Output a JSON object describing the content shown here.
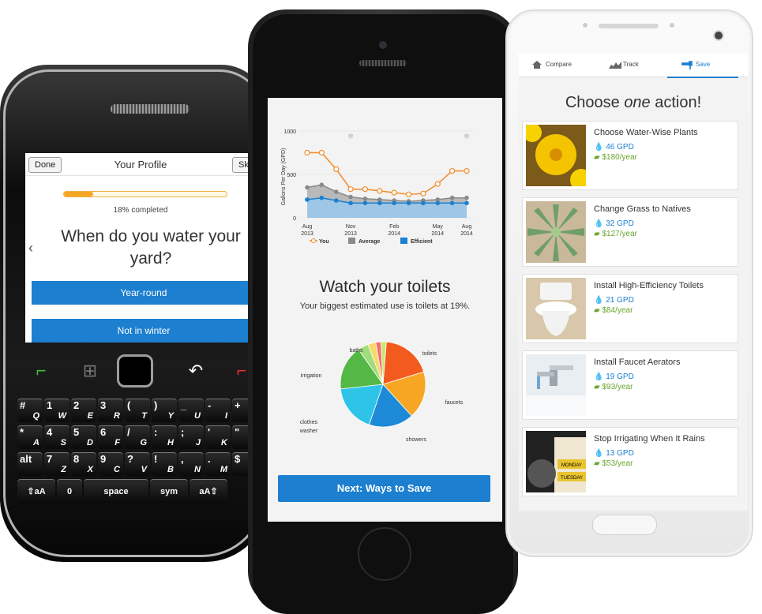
{
  "blackberry": {
    "done_label": "Done",
    "title": "Your Profile",
    "skip_label": "Sk",
    "progress_fraction": 0.18,
    "progress_text": "18% completed",
    "back_glyph": "‹",
    "question": "When do you water your yard?",
    "options": [
      "Year-round",
      "Not in winter"
    ],
    "keys": {
      "row1": [
        [
          "#",
          "Q",
          ""
        ],
        [
          "1",
          "W",
          ""
        ],
        [
          "2",
          "E",
          ""
        ],
        [
          "3",
          "R",
          ""
        ],
        [
          "(",
          "T",
          ""
        ],
        [
          ")",
          "Y",
          ""
        ],
        [
          "_",
          "U",
          ""
        ],
        [
          "-",
          "I",
          ""
        ],
        [
          "+",
          "O",
          ""
        ]
      ],
      "row2": [
        [
          "*",
          "A",
          ""
        ],
        [
          "4",
          "S",
          ""
        ],
        [
          "5",
          "D",
          ""
        ],
        [
          "6",
          "F",
          ""
        ],
        [
          "/",
          "G",
          ""
        ],
        [
          ":",
          "H",
          ""
        ],
        [
          ";",
          "J",
          ""
        ],
        [
          "'",
          "K",
          ""
        ],
        [
          "\"",
          "L",
          ""
        ]
      ],
      "row3": [
        [
          "alt",
          "",
          ""
        ],
        [
          "7",
          "Z",
          ""
        ],
        [
          "8",
          "X",
          ""
        ],
        [
          "9",
          "C",
          ""
        ],
        [
          "?",
          "V",
          ""
        ],
        [
          "!",
          "B",
          ""
        ],
        [
          ",",
          "N",
          ""
        ],
        [
          ".",
          "M",
          ""
        ],
        [
          "$",
          "",
          ""
        ]
      ],
      "row4": [
        "⇧aA",
        "0",
        "space",
        "sym",
        "aA⇧"
      ]
    }
  },
  "iphone": {
    "chart_data": {
      "type": "line",
      "ylabel": "Gallons Per Day (GPD)",
      "yticks": [
        "1000",
        "500",
        "0"
      ],
      "ylim": [
        0,
        1000
      ],
      "xticks": [
        "Aug 2013",
        "Nov 2013",
        "Feb 2014",
        "May 2014",
        "Aug 2014"
      ],
      "series": [
        {
          "name": "You",
          "values": [
            750,
            750,
            560,
            330,
            330,
            310,
            290,
            270,
            280,
            390,
            540,
            540
          ],
          "color": "#f28c28"
        },
        {
          "name": "Average",
          "values": [
            350,
            380,
            300,
            240,
            220,
            210,
            200,
            190,
            200,
            210,
            230,
            230
          ],
          "color": "#8a8a8a"
        },
        {
          "name": "Efficient",
          "values": [
            210,
            230,
            200,
            170,
            170,
            170,
            170,
            170,
            170,
            170,
            170,
            170
          ],
          "color": "#1c7fcf"
        }
      ]
    },
    "heading": "Watch your toilets",
    "subtext": "Your biggest estimated use is toilets at 19%.",
    "pie": {
      "type": "pie",
      "slices": [
        {
          "label": "toilets",
          "value": 19,
          "color": "#f25a1e"
        },
        {
          "label": "faucets",
          "value": 18,
          "color": "#f7a623"
        },
        {
          "label": "showers",
          "value": 17,
          "color": "#1c8ad6"
        },
        {
          "label": "clothes washer",
          "value": 18,
          "color": "#2ec4e8"
        },
        {
          "label": "irrigation",
          "value": 17,
          "color": "#55b846"
        },
        {
          "label": "baths",
          "value": 4,
          "color": "#9fdc7a"
        },
        {
          "label": "",
          "value": 3,
          "color": "#f7d86a"
        },
        {
          "label": "",
          "value": 2,
          "color": "#f76c6c"
        },
        {
          "label": "",
          "value": 2,
          "color": "#c6e870"
        }
      ]
    },
    "next_button": "Next: Ways to Save"
  },
  "android": {
    "tabs": [
      {
        "label": "Compare",
        "icon": "house-icon"
      },
      {
        "label": "Track",
        "icon": "chart-icon"
      },
      {
        "label": "Save",
        "icon": "faucet-icon",
        "selected": true
      }
    ],
    "title_pre": "Choose ",
    "title_em": "one",
    "title_post": " action!",
    "actions": [
      {
        "name": "Choose Water-Wise Plants",
        "gpd": "46 GPD",
        "cost": "$180/year",
        "thumb": "yellow-flowers"
      },
      {
        "name": "Change Grass to Natives",
        "gpd": "32 GPD",
        "cost": "$127/year",
        "thumb": "succulent"
      },
      {
        "name": "Install High-Efficiency Toilets",
        "gpd": "21 GPD",
        "cost": "$84/year",
        "thumb": "toilet"
      },
      {
        "name": "Install Faucet Aerators",
        "gpd": "19 GPD",
        "cost": "$93/year",
        "thumb": "faucet"
      },
      {
        "name": "Stop Irrigating When It Rains",
        "gpd": "13 GPD",
        "cost": "$53/year",
        "thumb": "sprinkler-controller"
      }
    ],
    "thumb_texts": [
      "MONDAY",
      "TUESDAY"
    ]
  }
}
